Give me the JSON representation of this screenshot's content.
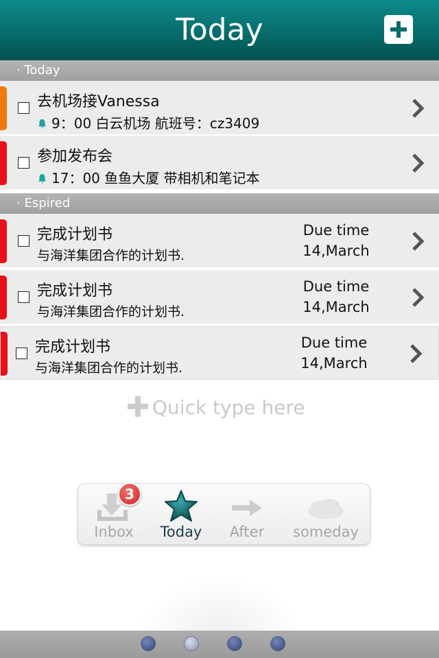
{
  "header": {
    "title": "Today",
    "add_icon": "plus-icon"
  },
  "sections": {
    "today": "· Today",
    "expired": "· Espired"
  },
  "today_items": [
    {
      "title": "去机场接Vanessa",
      "time": "9：00",
      "detail": "白云机场  航班号：cz3409",
      "flag_color": "#f07a10"
    },
    {
      "title": "参加发布会",
      "time": "17：00",
      "detail": "鱼鱼大厦  带相机和笔记本",
      "flag_color": "#e8101a"
    }
  ],
  "expired_items": [
    {
      "title": "完成计划书",
      "subtitle": "与海洋集团合作的计划书.",
      "due_label": "Due time",
      "due_date": "14,March",
      "flag_color": "#e8101a"
    },
    {
      "title": "完成计划书",
      "subtitle": "与海洋集团合作的计划书.",
      "due_label": "Due time",
      "due_date": "14,March",
      "flag_color": "#e8101a"
    },
    {
      "title": "完成计划书",
      "subtitle": "与海洋集团合作的计划书.",
      "due_label": "Due time",
      "due_date": "14,March",
      "flag_color": "#e8101a"
    }
  ],
  "quick_add": {
    "placeholder": "Quick type here"
  },
  "tabs": [
    {
      "label": "Inbox",
      "icon": "inbox-download-icon",
      "badge": "3"
    },
    {
      "label": "Today",
      "icon": "star-icon",
      "active": true
    },
    {
      "label": "After",
      "icon": "arrow-right-icon"
    },
    {
      "label": "someday",
      "icon": "cloud-icon"
    }
  ],
  "pager": {
    "pages": 4,
    "active": 2
  },
  "colors": {
    "accent": "#087272",
    "bell": "#1aa6a0"
  }
}
